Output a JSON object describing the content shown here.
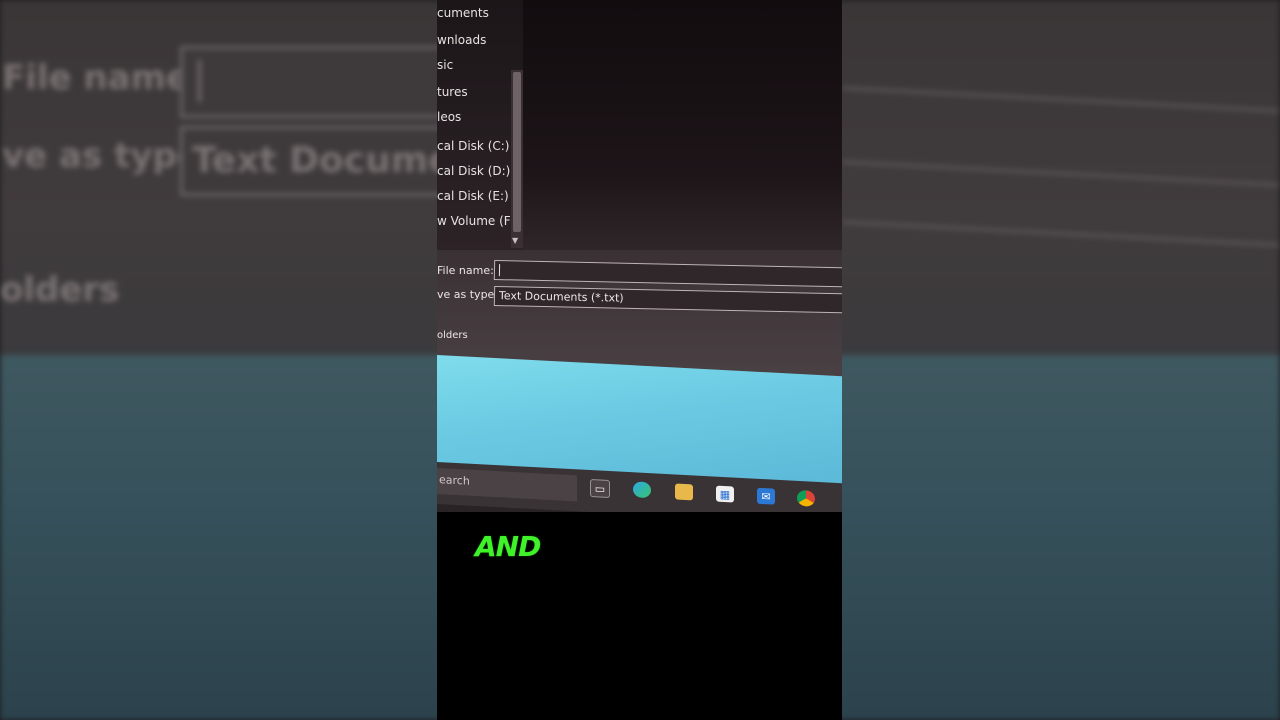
{
  "nav_pane": {
    "items": [
      "cuments",
      "wnloads",
      "sic",
      "tures",
      "leos",
      "cal Disk (C:)",
      "cal Disk (D:)",
      "cal Disk (E:)",
      "w Volume (F:)"
    ]
  },
  "save_form": {
    "file_name_label": "File name:",
    "file_name_value": "",
    "save_as_type_label": "ve as type:",
    "save_as_type_value": "Text Documents (*.txt)",
    "hide_folders_label": "olders"
  },
  "taskbar": {
    "search_text": "earch"
  },
  "caption": {
    "text": "AND",
    "color": "#3ff22a"
  },
  "background_zoom": {
    "file_name_label": "File name",
    "save_as_type_label": "ve as type",
    "save_as_type_value": "Text Document",
    "folders_label": "olders"
  }
}
